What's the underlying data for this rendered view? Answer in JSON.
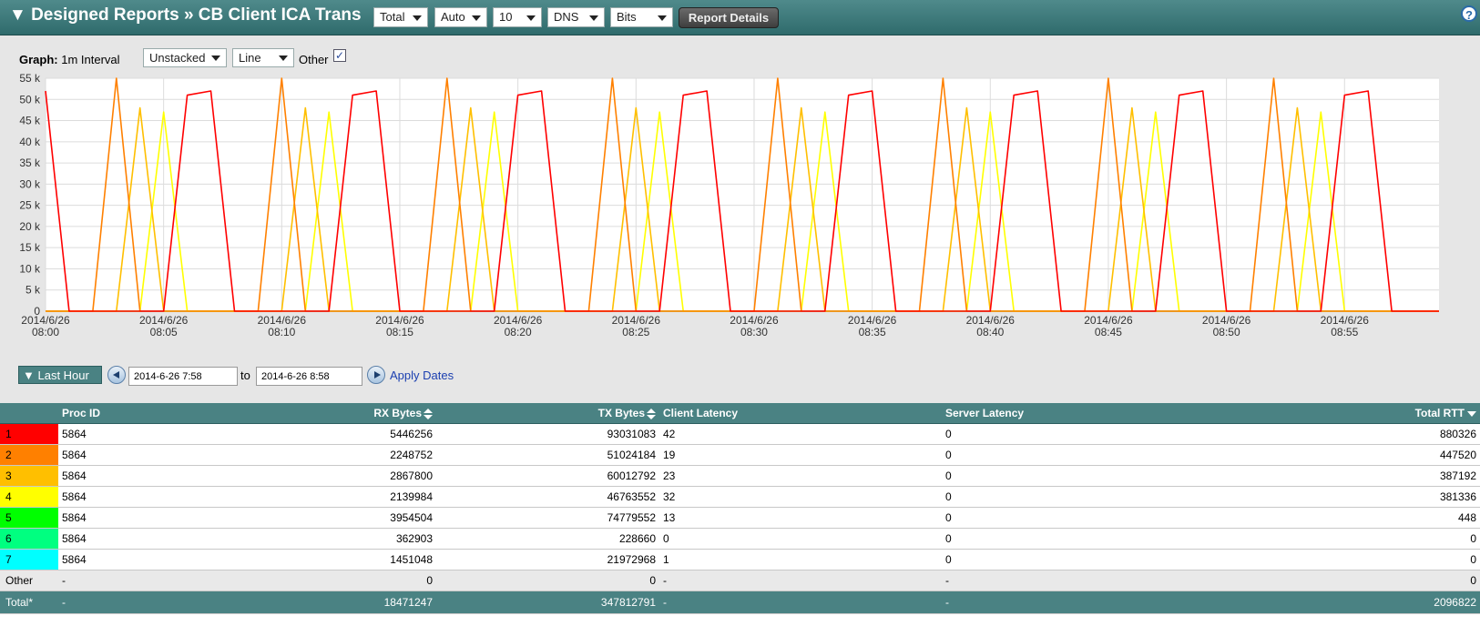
{
  "header": {
    "title": "▼ Designed Reports » CB Client ICA Trans",
    "selects": [
      "Total",
      "Auto",
      "10",
      "DNS",
      "Bits"
    ],
    "report_details": "Report Details",
    "help": "?"
  },
  "graph": {
    "label_bold": "Graph:",
    "interval": "1m Interval",
    "stack_select": "Unstacked",
    "type_select": "Line",
    "other_label": "Other",
    "other_checked": "✓"
  },
  "dates": {
    "range_button": "Last Hour",
    "from": "2014-6-26 7:58",
    "to_label": "to",
    "to": "2014-6-26 8:58",
    "apply": "Apply Dates"
  },
  "colors": {
    "accent": "#4a8283",
    "series": [
      "#ff0000",
      "#ff8000",
      "#ffbf00",
      "#ffff00",
      "#00ff00",
      "#00ff80",
      "#00ffff"
    ]
  },
  "chart_data": {
    "type": "line",
    "ylim": [
      0,
      55000
    ],
    "yticks": [
      "0",
      "5 k",
      "10 k",
      "15 k",
      "20 k",
      "25 k",
      "30 k",
      "35 k",
      "40 k",
      "45 k",
      "50 k",
      "55 k"
    ],
    "xticks": [
      [
        "2014/6/26",
        "08:00"
      ],
      [
        "2014/6/26",
        "08:05"
      ],
      [
        "2014/6/26",
        "08:10"
      ],
      [
        "2014/6/26",
        "08:15"
      ],
      [
        "2014/6/26",
        "08:20"
      ],
      [
        "2014/6/26",
        "08:25"
      ],
      [
        "2014/6/26",
        "08:30"
      ],
      [
        "2014/6/26",
        "08:35"
      ],
      [
        "2014/6/26",
        "08:40"
      ],
      [
        "2014/6/26",
        "08:45"
      ],
      [
        "2014/6/26",
        "08:50"
      ],
      [
        "2014/6/26",
        "08:55"
      ]
    ],
    "x_start": "2014-06-26 08:00",
    "x_end": "2014-06-26 08:59",
    "grid": true,
    "series": [
      {
        "color": "#ff0000",
        "x": [
          "08:00",
          "08:01",
          "08:02",
          "08:03",
          "08:04",
          "08:05",
          "08:06",
          "08:07",
          "08:08",
          "08:09",
          "08:10",
          "08:11",
          "08:12",
          "08:13",
          "08:14",
          "08:15",
          "08:16",
          "08:17",
          "08:18",
          "08:19",
          "08:20",
          "08:21",
          "08:22",
          "08:23",
          "08:24",
          "08:25",
          "08:26",
          "08:27",
          "08:28",
          "08:29",
          "08:30",
          "08:31",
          "08:32",
          "08:33",
          "08:34",
          "08:35",
          "08:36",
          "08:37",
          "08:38",
          "08:39",
          "08:40",
          "08:41",
          "08:42",
          "08:43",
          "08:44",
          "08:45",
          "08:46",
          "08:47",
          "08:48",
          "08:49",
          "08:50",
          "08:51",
          "08:52",
          "08:53",
          "08:54",
          "08:55",
          "08:56",
          "08:57",
          "08:58",
          "08:59"
        ],
        "values": [
          52000,
          0,
          0,
          0,
          0,
          0,
          51000,
          52000,
          0,
          0,
          0,
          0,
          0,
          51000,
          52000,
          0,
          0,
          0,
          0,
          0,
          51000,
          52000,
          0,
          0,
          0,
          0,
          0,
          51000,
          52000,
          0,
          0,
          0,
          0,
          0,
          51000,
          52000,
          0,
          0,
          0,
          0,
          0,
          51000,
          52000,
          0,
          0,
          0,
          0,
          0,
          51000,
          52000,
          0,
          0,
          0,
          0,
          0,
          51000,
          52000,
          0,
          0,
          0
        ]
      },
      {
        "color": "#ff8000",
        "x": [
          "08:00",
          "08:01",
          "08:02",
          "08:03",
          "08:04",
          "08:05",
          "08:06",
          "08:07",
          "08:08",
          "08:09",
          "08:10",
          "08:11",
          "08:12",
          "08:13",
          "08:14",
          "08:15",
          "08:16",
          "08:17",
          "08:18",
          "08:19",
          "08:20",
          "08:21",
          "08:22",
          "08:23",
          "08:24",
          "08:25",
          "08:26",
          "08:27",
          "08:28",
          "08:29",
          "08:30",
          "08:31",
          "08:32",
          "08:33",
          "08:34",
          "08:35",
          "08:36",
          "08:37",
          "08:38",
          "08:39",
          "08:40",
          "08:41",
          "08:42",
          "08:43",
          "08:44",
          "08:45",
          "08:46",
          "08:47",
          "08:48",
          "08:49",
          "08:50",
          "08:51",
          "08:52",
          "08:53",
          "08:54",
          "08:55",
          "08:56",
          "08:57",
          "08:58",
          "08:59"
        ],
        "values": [
          0,
          0,
          0,
          55000,
          0,
          0,
          0,
          0,
          0,
          0,
          55000,
          0,
          0,
          0,
          0,
          0,
          0,
          55000,
          0,
          0,
          0,
          0,
          0,
          0,
          55000,
          0,
          0,
          0,
          0,
          0,
          0,
          55000,
          0,
          0,
          0,
          0,
          0,
          0,
          55000,
          0,
          0,
          0,
          0,
          0,
          0,
          55000,
          0,
          0,
          0,
          0,
          0,
          0,
          55000,
          0,
          0,
          0,
          0,
          0,
          0,
          0
        ]
      },
      {
        "color": "#ffbf00",
        "x": [
          "08:00",
          "08:01",
          "08:02",
          "08:03",
          "08:04",
          "08:05",
          "08:06",
          "08:07",
          "08:08",
          "08:09",
          "08:10",
          "08:11",
          "08:12",
          "08:13",
          "08:14",
          "08:15",
          "08:16",
          "08:17",
          "08:18",
          "08:19",
          "08:20",
          "08:21",
          "08:22",
          "08:23",
          "08:24",
          "08:25",
          "08:26",
          "08:27",
          "08:28",
          "08:29",
          "08:30",
          "08:31",
          "08:32",
          "08:33",
          "08:34",
          "08:35",
          "08:36",
          "08:37",
          "08:38",
          "08:39",
          "08:40",
          "08:41",
          "08:42",
          "08:43",
          "08:44",
          "08:45",
          "08:46",
          "08:47",
          "08:48",
          "08:49",
          "08:50",
          "08:51",
          "08:52",
          "08:53",
          "08:54",
          "08:55",
          "08:56",
          "08:57",
          "08:58",
          "08:59"
        ],
        "values": [
          0,
          0,
          0,
          0,
          48000,
          0,
          0,
          0,
          0,
          0,
          0,
          48000,
          0,
          0,
          0,
          0,
          0,
          0,
          48000,
          0,
          0,
          0,
          0,
          0,
          0,
          48000,
          0,
          0,
          0,
          0,
          0,
          0,
          48000,
          0,
          0,
          0,
          0,
          0,
          0,
          48000,
          0,
          0,
          0,
          0,
          0,
          0,
          48000,
          0,
          0,
          0,
          0,
          0,
          0,
          48000,
          0,
          0,
          0,
          0,
          0,
          0
        ]
      },
      {
        "color": "#ffff00",
        "x": [
          "08:00",
          "08:01",
          "08:02",
          "08:03",
          "08:04",
          "08:05",
          "08:06",
          "08:07",
          "08:08",
          "08:09",
          "08:10",
          "08:11",
          "08:12",
          "08:13",
          "08:14",
          "08:15",
          "08:16",
          "08:17",
          "08:18",
          "08:19",
          "08:20",
          "08:21",
          "08:22",
          "08:23",
          "08:24",
          "08:25",
          "08:26",
          "08:27",
          "08:28",
          "08:29",
          "08:30",
          "08:31",
          "08:32",
          "08:33",
          "08:34",
          "08:35",
          "08:36",
          "08:37",
          "08:38",
          "08:39",
          "08:40",
          "08:41",
          "08:42",
          "08:43",
          "08:44",
          "08:45",
          "08:46",
          "08:47",
          "08:48",
          "08:49",
          "08:50",
          "08:51",
          "08:52",
          "08:53",
          "08:54",
          "08:55",
          "08:56",
          "08:57",
          "08:58",
          "08:59"
        ],
        "values": [
          0,
          0,
          0,
          0,
          0,
          47000,
          0,
          0,
          0,
          0,
          0,
          0,
          47000,
          0,
          0,
          0,
          0,
          0,
          0,
          47000,
          0,
          0,
          0,
          0,
          0,
          0,
          47000,
          0,
          0,
          0,
          0,
          0,
          0,
          47000,
          0,
          0,
          0,
          0,
          0,
          0,
          47000,
          0,
          0,
          0,
          0,
          0,
          0,
          47000,
          0,
          0,
          0,
          0,
          0,
          0,
          47000,
          0,
          0,
          0,
          0,
          0
        ]
      },
      {
        "color": "#00ffff",
        "x": [
          "08:00",
          "08:59"
        ],
        "values": [
          0,
          0
        ]
      }
    ]
  },
  "table": {
    "headers": [
      "",
      "Proc ID",
      "RX Bytes",
      "TX Bytes",
      "Client Latency",
      "Server Latency",
      "Total RTT"
    ],
    "rows": [
      {
        "rank": "1",
        "color": "#ff0000",
        "proc": "5864",
        "rx": "5446256",
        "tx": "93031083",
        "client": "42",
        "server": "0",
        "rtt": "880326"
      },
      {
        "rank": "2",
        "color": "#ff8000",
        "proc": "5864",
        "rx": "2248752",
        "tx": "51024184",
        "client": "19",
        "server": "0",
        "rtt": "447520"
      },
      {
        "rank": "3",
        "color": "#ffbf00",
        "proc": "5864",
        "rx": "2867800",
        "tx": "60012792",
        "client": "23",
        "server": "0",
        "rtt": "387192"
      },
      {
        "rank": "4",
        "color": "#ffff00",
        "proc": "5864",
        "rx": "2139984",
        "tx": "46763552",
        "client": "32",
        "server": "0",
        "rtt": "381336"
      },
      {
        "rank": "5",
        "color": "#00ff00",
        "proc": "5864",
        "rx": "3954504",
        "tx": "74779552",
        "client": "13",
        "server": "0",
        "rtt": "448"
      },
      {
        "rank": "6",
        "color": "#00ff80",
        "proc": "5864",
        "rx": "362903",
        "tx": "228660",
        "client": "0",
        "server": "0",
        "rtt": "0"
      },
      {
        "rank": "7",
        "color": "#00ffff",
        "proc": "5864",
        "rx": "1451048",
        "tx": "21972968",
        "client": "1",
        "server": "0",
        "rtt": "0"
      }
    ],
    "other": {
      "rank": "Other",
      "proc": "-",
      "rx": "0",
      "tx": "0",
      "client": "-",
      "server": "-",
      "rtt": "0"
    },
    "total": {
      "rank": "Total*",
      "proc": "-",
      "rx": "18471247",
      "tx": "347812791",
      "client": "-",
      "server": "-",
      "rtt": "2096822"
    }
  }
}
